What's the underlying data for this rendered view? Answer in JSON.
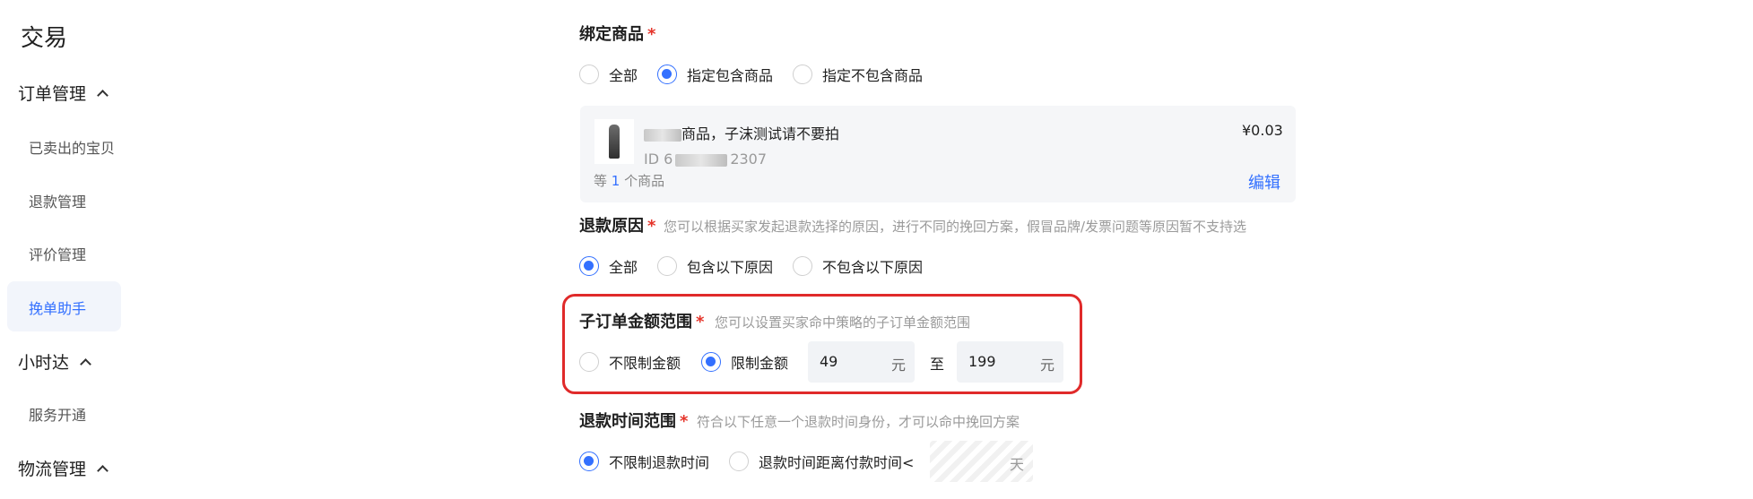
{
  "sidebar": {
    "title": "交易",
    "groups": [
      {
        "label": "订单管理",
        "items": [
          "已卖出的宝贝",
          "退款管理",
          "评价管理",
          "挽单助手"
        ]
      },
      {
        "label": "小时达",
        "items": [
          "服务开通"
        ]
      },
      {
        "label": "物流管理",
        "items": []
      }
    ],
    "active_item": "挽单助手"
  },
  "form": {
    "bind_product": {
      "label": "绑定商品",
      "required": "*",
      "options": [
        "全部",
        "指定包含商品",
        "指定不包含商品"
      ],
      "selected": "指定包含商品",
      "product": {
        "name_visible": "商品，子沫测试请不要拍",
        "price": "¥0.03",
        "id_prefix": "ID 6",
        "id_suffix": "2307",
        "count_prefix": "等",
        "count": "1",
        "count_suffix": "个商品",
        "edit_label": "编辑"
      }
    },
    "refund_reason": {
      "label": "退款原因",
      "required": "*",
      "hint": "您可以根据买家发起退款选择的原因，进行不同的挽回方案，假冒品牌/发票问题等原因暂不支持选",
      "options": [
        "全部",
        "包含以下原因",
        "不包含以下原因"
      ],
      "selected": "全部"
    },
    "amount_range": {
      "label": "子订单金额范围",
      "required": "*",
      "hint": "您可以设置买家命中策略的子订单金额范围",
      "options": [
        "不限制金额",
        "限制金额"
      ],
      "selected": "限制金额",
      "min_value": "49",
      "max_value": "199",
      "unit": "元",
      "to_label": "至"
    },
    "refund_time": {
      "label": "退款时间范围",
      "required": "*",
      "hint": "符合以下任意一个退款时间身份，才可以命中挽回方案",
      "options": [
        "不限制退款时间",
        "退款时间距离付款时间<"
      ],
      "selected": "不限制退款时间",
      "unit": "天"
    }
  },
  "colors": {
    "accent": "#3370ff",
    "required_star": "#e5342a",
    "highlight_border": "#e02a2a"
  }
}
